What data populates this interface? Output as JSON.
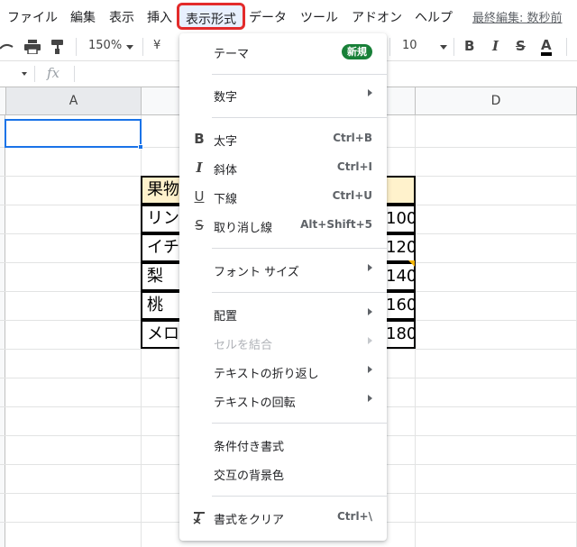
{
  "menubar": {
    "items": [
      "ファイル",
      "編集",
      "表示",
      "挿入",
      "表示形式",
      "データ",
      "ツール",
      "アドオン",
      "ヘルプ"
    ],
    "last_edit": "最終編集: 数秒前"
  },
  "toolbar": {
    "zoom": "150%",
    "currency": "¥",
    "font_size": "10",
    "bold": "B",
    "italic": "I",
    "strike": "S",
    "text_color": "A"
  },
  "formula_bar": {
    "fx": "fx",
    "value": ""
  },
  "columns": [
    "A",
    "",
    "",
    "D"
  ],
  "table": {
    "header": "果物",
    "rows": [
      {
        "name": "リン",
        "price": "100"
      },
      {
        "name": "イチ",
        "price": "120"
      },
      {
        "name": "梨",
        "price": "140"
      },
      {
        "name": "桃",
        "price": "160"
      },
      {
        "name": "メロ",
        "price": "180"
      }
    ]
  },
  "format_menu": {
    "theme": "テーマ",
    "new_badge": "新規",
    "number": "数字",
    "bold": "太字",
    "bold_shortcut": "Ctrl+B",
    "italic": "斜体",
    "italic_shortcut": "Ctrl+I",
    "underline": "下線",
    "underline_shortcut": "Ctrl+U",
    "strikethrough": "取り消し線",
    "strikethrough_shortcut": "Alt+Shift+5",
    "font_size": "フォント サイズ",
    "align": "配置",
    "merge_cells": "セルを結合",
    "wrap_text": "テキストの折り返し",
    "rotate_text": "テキストの回転",
    "conditional_format": "条件付き書式",
    "alternating_colors": "交互の背景色",
    "clear_format": "書式をクリア",
    "clear_format_shortcut": "Ctrl+\\"
  },
  "colors": {
    "highlight_border": "#e32b2b",
    "selection": "#1a73e8",
    "header_fill": "#fff2cc",
    "badge": "#188038"
  }
}
